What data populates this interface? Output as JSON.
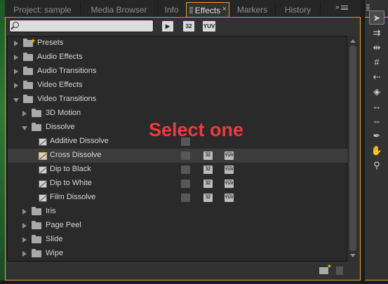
{
  "tabs": [
    {
      "label": "Project: sample"
    },
    {
      "label": "Media Browser"
    },
    {
      "label": "Info"
    },
    {
      "label": "Effects",
      "active": true,
      "close": "×"
    },
    {
      "label": "Markers"
    },
    {
      "label": "History"
    }
  ],
  "panel_menu_glyph": "»",
  "search": {
    "value": "",
    "placeholder": ""
  },
  "filters": {
    "accelerated": "▶",
    "bit32": "32",
    "yuv": "YUV"
  },
  "tree": [
    {
      "label": "Presets",
      "level": 0,
      "kind": "folder-star",
      "expanded": false
    },
    {
      "label": "Audio Effects",
      "level": 0,
      "kind": "folder",
      "expanded": false
    },
    {
      "label": "Audio Transitions",
      "level": 0,
      "kind": "folder",
      "expanded": false
    },
    {
      "label": "Video Effects",
      "level": 0,
      "kind": "folder",
      "expanded": false
    },
    {
      "label": "Video Transitions",
      "level": 0,
      "kind": "folder",
      "expanded": true
    },
    {
      "label": "3D Motion",
      "level": 1,
      "kind": "folder",
      "expanded": false
    },
    {
      "label": "Dissolve",
      "level": 1,
      "kind": "folder",
      "expanded": true
    },
    {
      "label": "Additive Dissolve",
      "level": 2,
      "kind": "effect",
      "badges": [
        false,
        null,
        null
      ]
    },
    {
      "label": "Cross Dissolve",
      "level": 2,
      "kind": "effect",
      "selected": true,
      "badges": [
        false,
        true,
        true
      ]
    },
    {
      "label": "Dip to Black",
      "level": 2,
      "kind": "effect",
      "badges": [
        false,
        true,
        true
      ]
    },
    {
      "label": "Dip to White",
      "level": 2,
      "kind": "effect",
      "badges": [
        false,
        true,
        true
      ]
    },
    {
      "label": "Film Dissolve",
      "level": 2,
      "kind": "effect",
      "badges": [
        false,
        true,
        true
      ]
    },
    {
      "label": "Iris",
      "level": 1,
      "kind": "folder",
      "expanded": false
    },
    {
      "label": "Page Peel",
      "level": 1,
      "kind": "folder",
      "expanded": false
    },
    {
      "label": "Slide",
      "level": 1,
      "kind": "folder",
      "expanded": false
    },
    {
      "label": "Wipe",
      "level": 1,
      "kind": "folder",
      "expanded": false
    }
  ],
  "badge_text": [
    "",
    "32",
    "YUV"
  ],
  "annotation": "Select one",
  "tools": [
    {
      "name": "selection-tool-icon",
      "glyph": "➤",
      "active": true
    },
    {
      "name": "track-select-tool-icon",
      "glyph": "⇉"
    },
    {
      "name": "ripple-edit-tool-icon",
      "glyph": "⇹"
    },
    {
      "name": "rolling-edit-tool-icon",
      "glyph": "#"
    },
    {
      "name": "rate-stretch-tool-icon",
      "glyph": "⇠"
    },
    {
      "name": "razor-tool-icon",
      "glyph": "◈"
    },
    {
      "name": "slip-tool-icon",
      "glyph": "↔"
    },
    {
      "name": "slide-tool-icon",
      "glyph": "⇔"
    },
    {
      "name": "pen-tool-icon",
      "glyph": "✒"
    },
    {
      "name": "hand-tool-icon",
      "glyph": "✋"
    },
    {
      "name": "zoom-tool-icon",
      "glyph": "⚲"
    }
  ],
  "colors": {
    "accent": "#e0a33a",
    "annotation": "#f03a3a",
    "panel": "#323232"
  }
}
